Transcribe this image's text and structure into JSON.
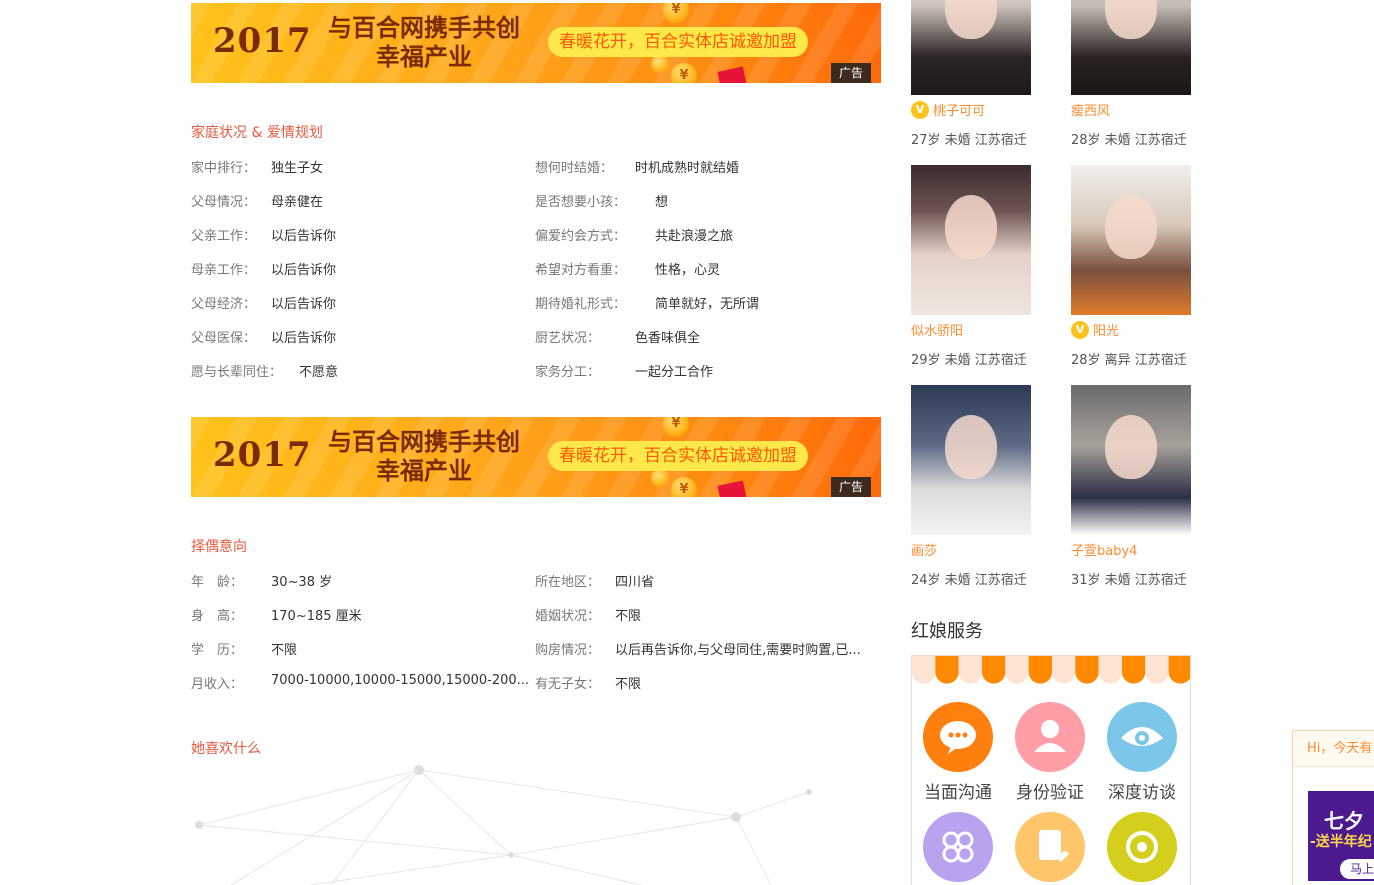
{
  "ads": [
    {
      "year": "2017",
      "slogan_line1": "与百合网携手共创",
      "slogan_line2": "幸福产业",
      "pill": "春暖花开，百合实体店诚邀加盟",
      "tag": "广告",
      "coin": "¥"
    },
    {
      "year": "2017",
      "slogan_line1": "与百合网携手共创",
      "slogan_line2": "幸福产业",
      "pill": "春暖花开，百合实体店诚邀加盟",
      "tag": "广告",
      "coin": "¥"
    }
  ],
  "family": {
    "title": "家庭状况 & 爱情规划",
    "left": [
      {
        "label": "家中排行：",
        "value": "独生子女"
      },
      {
        "label": "父母情况：",
        "value": "母亲健在"
      },
      {
        "label": "父亲工作：",
        "value": "以后告诉你"
      },
      {
        "label": "母亲工作：",
        "value": "以后告诉你"
      },
      {
        "label": "父母经济：",
        "value": "以后告诉你"
      },
      {
        "label": "父母医保：",
        "value": "以后告诉你"
      },
      {
        "label": "愿与长辈同住：",
        "value": "不愿意"
      }
    ],
    "right": [
      {
        "label": "想何时结婚：",
        "value": "时机成熟时就结婚"
      },
      {
        "label": "是否想要小孩：",
        "value": "想"
      },
      {
        "label": "偏爱约会方式：",
        "value": "共赴浪漫之旅"
      },
      {
        "label": "希望对方看重：",
        "value": "性格，心灵"
      },
      {
        "label": "期待婚礼形式：",
        "value": "简单就好，无所谓"
      },
      {
        "label": "厨艺状况：",
        "value": "色香味俱全"
      },
      {
        "label": "家务分工：",
        "value": "一起分工合作"
      }
    ]
  },
  "partner": {
    "title": "择偶意向",
    "left": [
      {
        "label": "年　龄：",
        "value": "30~38 岁"
      },
      {
        "label": "身　高：",
        "value": "170~185 厘米"
      },
      {
        "label": "学　历：",
        "value": "不限"
      },
      {
        "label": "月收入：",
        "value": "7000-10000,10000-15000,15000-200..."
      }
    ],
    "right": [
      {
        "label": "所在地区：",
        "value": "四川省"
      },
      {
        "label": "婚姻状况：",
        "value": "不限"
      },
      {
        "label": "购房情况：",
        "value": "以后再告诉你,与父母同住,需要时购置,已..."
      },
      {
        "label": "有无子女：",
        "value": "不限"
      }
    ]
  },
  "likes": {
    "title": "她喜欢什么"
  },
  "profiles": [
    {
      "name": "桃子可可",
      "verified": true,
      "badge": "V",
      "meta": "27岁 未婚 江苏宿迁"
    },
    {
      "name": "瘦西风",
      "verified": false,
      "badge": "",
      "meta": "28岁 未婚 江苏宿迁"
    },
    {
      "name": "似水骄阳",
      "verified": false,
      "badge": "",
      "meta": "29岁 未婚 江苏宿迁"
    },
    {
      "name": "阳光",
      "verified": true,
      "badge": "V",
      "meta": "28岁 离异 江苏宿迁"
    },
    {
      "name": "画莎",
      "verified": false,
      "badge": "",
      "meta": "24岁 未婚 江苏宿迁"
    },
    {
      "name": "子萱baby4",
      "verified": false,
      "badge": "",
      "meta": "31岁 未婚 江苏宿迁"
    }
  ],
  "service": {
    "title": "红娘服务",
    "items": [
      {
        "label": "当面沟通",
        "color": "#ff7f0f"
      },
      {
        "label": "身份验证",
        "color": "#ff9ea6"
      },
      {
        "label": "深度访谈",
        "color": "#7cc6ea"
      },
      {
        "label": "",
        "color": "#b9a3ee"
      },
      {
        "label": "",
        "color": "#ffc56b"
      },
      {
        "label": "",
        "color": "#d4cf1d"
      }
    ]
  },
  "promo": {
    "greeting": "Hi，今天有",
    "title": "七夕",
    "subtitle": "-送半年纪",
    "button": "马上"
  },
  "colors": {
    "accent": "#e8593f",
    "name": "#ff8b2c",
    "awning_orange": "#ff8a00",
    "awning_light": "#ffe3d4"
  }
}
